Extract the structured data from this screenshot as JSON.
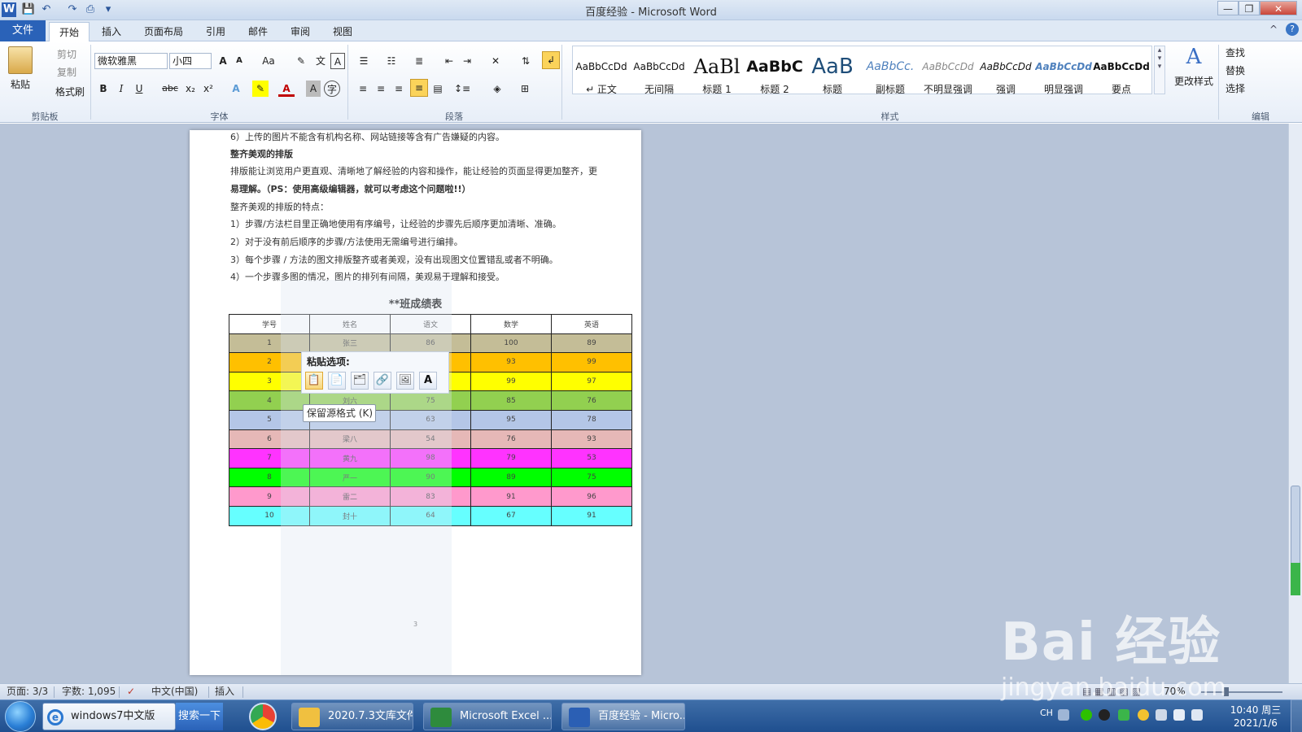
{
  "window": {
    "title": "百度经验 - Microsoft Word",
    "min_glyph": "—",
    "restore_glyph": "❐",
    "close_glyph": "✕",
    "ribbon_min_glyph": "^",
    "help_glyph": "?"
  },
  "qat": {
    "word_glyph": "W",
    "save_glyph": "💾",
    "undo_glyph": "↶",
    "redo_glyph": "↷",
    "preview_glyph": "⎙",
    "more_glyph": "▾"
  },
  "tabs": [
    "文件",
    "开始",
    "插入",
    "页面布局",
    "引用",
    "邮件",
    "审阅",
    "视图"
  ],
  "clipboard": {
    "paste": "粘贴",
    "cut": "剪切",
    "copy": "复制",
    "format_painter": "格式刷",
    "group": "剪贴板"
  },
  "font": {
    "name": "微软雅黑",
    "size": "小四",
    "bold": "B",
    "italic": "I",
    "underline": "U",
    "strike": "abc",
    "sub": "x₂",
    "sup": "x²",
    "group": "字体"
  },
  "paragraph": {
    "group": "段落"
  },
  "styles": {
    "group": "样式",
    "change": "更改样式",
    "items": [
      {
        "preview": "AaBbCcDd",
        "name": "↵ 正文"
      },
      {
        "preview": "AaBbCcDd",
        "name": "无间隔"
      },
      {
        "preview": "AaBl",
        "name": "标题 1"
      },
      {
        "preview": "AaBbC",
        "name": "标题 2"
      },
      {
        "preview": "AaB",
        "name": "标题"
      },
      {
        "preview": "AaBbCc.",
        "name": "副标题"
      },
      {
        "preview": "AaBbCcDd",
        "name": "不明显强调"
      },
      {
        "preview": "AaBbCcDd",
        "name": "强调"
      },
      {
        "preview": "AaBbCcDd",
        "name": "明显强调"
      },
      {
        "preview": "AaBbCcDd",
        "name": "要点"
      }
    ]
  },
  "editing": {
    "find": "查找",
    "replace": "替换",
    "select": "选择",
    "group": "编辑"
  },
  "document": {
    "lines": [
      "6）上传的图片不能含有机构名称、网站链接等含有广告嫌疑的内容。",
      "整齐美观的排版",
      "排版能让浏览用户更直观、清晰地了解经验的内容和操作，能让经验的页面显得更加整齐，更",
      "易理解。（PS：使用高级编辑器，就可以考虑这个问题啦!!）",
      "整齐美观的排版的特点：",
      "1）步骤/方法栏目里正确地使用有序编号，让经验的步骤先后顺序更加清晰、准确。",
      "2）对于没有前后顺序的步骤/方法使用无需编号进行编排。",
      "3）每个步骤 / 方法的图文排版整齐或者美观，没有出现图文位置错乱或者不明确。",
      "4）一个步骤多图的情况，图片的排列有间隔，美观易于理解和接受。"
    ],
    "table_title": "**班成绩表",
    "page_number": "3",
    "table_headers": [
      "学号",
      "姓名",
      "语文",
      "数学",
      "英语"
    ],
    "table_rows": [
      [
        "1",
        "张三",
        "86",
        "100",
        "89"
      ],
      [
        "2",
        "",
        "",
        "93",
        "99"
      ],
      [
        "3",
        "",
        "",
        "99",
        "97"
      ],
      [
        "4",
        "刘六",
        "75",
        "85",
        "76"
      ],
      [
        "5",
        "",
        "63",
        "95",
        "78"
      ],
      [
        "6",
        "梁八",
        "54",
        "76",
        "93"
      ],
      [
        "7",
        "黄九",
        "98",
        "79",
        "53"
      ],
      [
        "8",
        "严一",
        "90",
        "89",
        "75"
      ],
      [
        "9",
        "雷二",
        "83",
        "91",
        "96"
      ],
      [
        "10",
        "封十",
        "64",
        "67",
        "91"
      ]
    ],
    "row_colors": [
      "#c4bd97",
      "#ffc000",
      "#ffff00",
      "#92d050",
      "#b4c6e7",
      "#e6b8b7",
      "#ff33ff",
      "#00ff00",
      "#ff99cc",
      "#66ffff"
    ]
  },
  "paste_popup": {
    "title": "粘贴选项:",
    "icons": [
      "📋",
      "📄",
      "🗂",
      "🔗",
      "🖼",
      "A"
    ],
    "tooltip": "保留源格式 (K)"
  },
  "status": {
    "page": "页面: 3/3",
    "words": "字数: 1,095",
    "language": "中文(中国)",
    "mode": "插入",
    "zoom": "70%"
  },
  "taskbar": {
    "ie_label": "windows7中文版",
    "search_label": "搜索一下",
    "items": [
      {
        "label": "2020.7.3文库文件",
        "icon_color": "#f0c040"
      },
      {
        "label": "Microsoft Excel ...",
        "icon_color": "#2e8b3d"
      },
      {
        "label": "百度经验 - Micro...",
        "icon_color": "#2b5fb4"
      }
    ],
    "ime": "CH",
    "time": "10:40 周三",
    "date": "2021/1/6"
  },
  "watermark": {
    "brand": "Bai 经验",
    "url": "jingyan.baidu.com"
  }
}
